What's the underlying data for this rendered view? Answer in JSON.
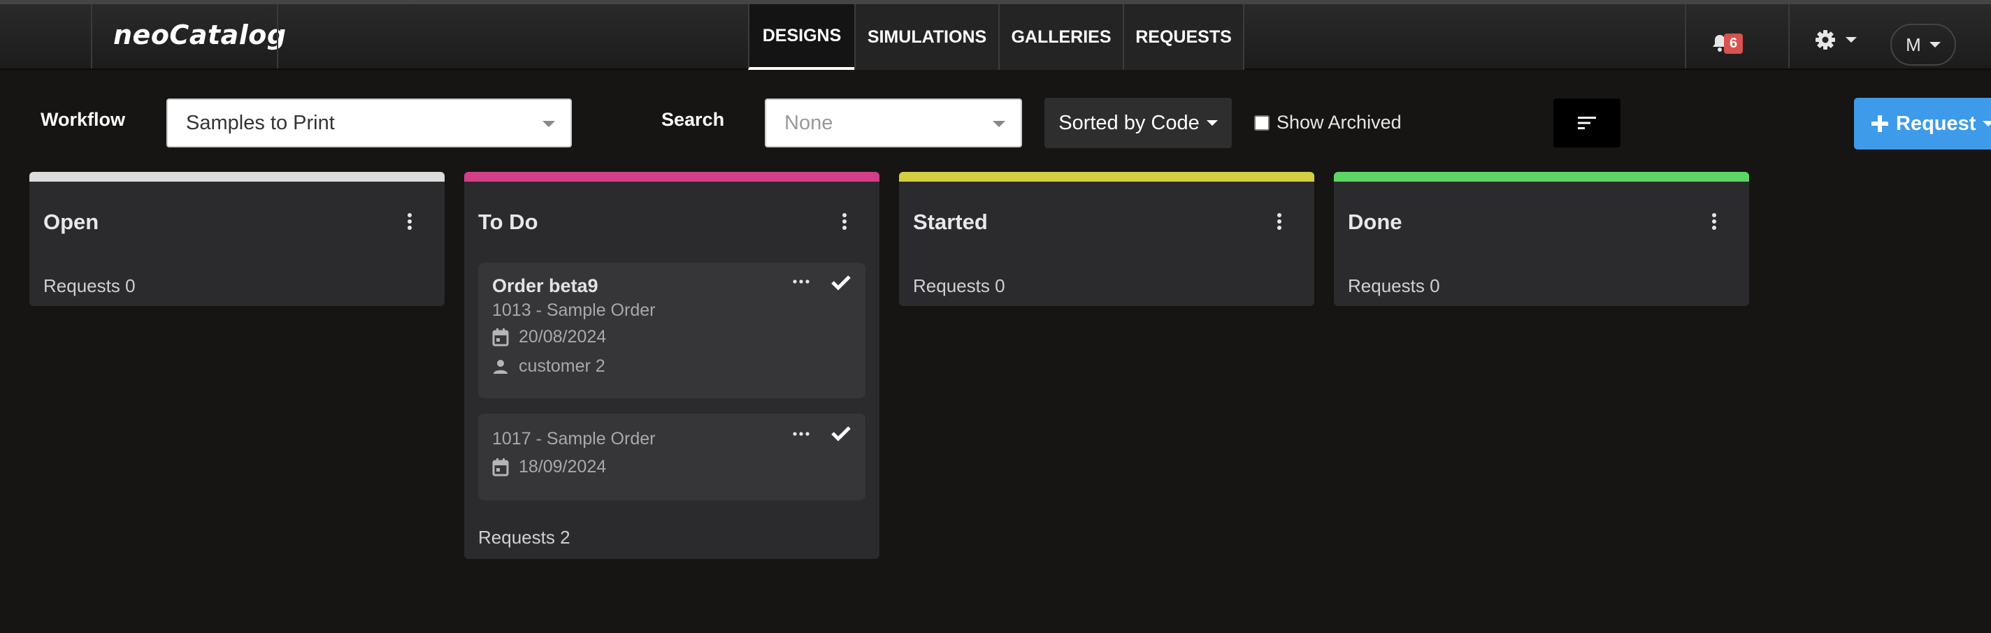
{
  "app": {
    "logo": "neoCatalog"
  },
  "nav": {
    "tabs": [
      {
        "label": "DESIGNS",
        "active": true
      },
      {
        "label": "SIMULATIONS",
        "active": false
      },
      {
        "label": "GALLERIES",
        "active": false
      },
      {
        "label": "REQUESTS",
        "active": false
      }
    ],
    "notification_count": "6",
    "user_initial": "M",
    "icons": [
      "bell-icon",
      "gear-icon",
      "chevron-down-icon"
    ]
  },
  "toolbar": {
    "workflow_label": "Workflow",
    "workflow_value": "Samples to Print",
    "search_label": "Search",
    "search_value": "None",
    "sort_label": "Sorted by Code",
    "show_archived_label": "Show Archived",
    "show_archived_checked": false,
    "request_button_label": "Request"
  },
  "columns": [
    {
      "title": "Open",
      "color": "#dcdcdc",
      "count_label": "Requests 0",
      "cards": []
    },
    {
      "title": "To Do",
      "color": "#d33f86",
      "count_label": "Requests 2",
      "cards": [
        {
          "title": "Order beta9",
          "subtitle": "1013 - Sample Order",
          "date": "20/08/2024",
          "customer": "customer 2"
        },
        {
          "title": "",
          "subtitle": "1017 - Sample Order",
          "date": "18/09/2024",
          "customer": ""
        }
      ]
    },
    {
      "title": "Started",
      "color": "#d4cf41",
      "count_label": "Requests 0",
      "cards": []
    },
    {
      "title": "Done",
      "color": "#5bd663",
      "count_label": "Requests 0",
      "cards": []
    }
  ],
  "colors": {
    "accent": "#3d9be9",
    "badge": "#d9534f",
    "background": "#161514",
    "panel": "#2b2a2c"
  }
}
